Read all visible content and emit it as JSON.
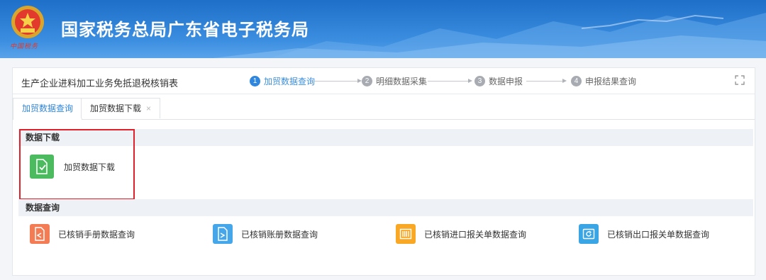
{
  "header": {
    "title": "国家税务总局广东省电子税务局",
    "signature": "中国税务"
  },
  "form": {
    "title": "生产企业进料加工业务免抵退税核销表"
  },
  "steps": [
    {
      "num": "1",
      "label": "加贸数据查询"
    },
    {
      "num": "2",
      "label": "明细数据采集"
    },
    {
      "num": "3",
      "label": "数据申报"
    },
    {
      "num": "4",
      "label": "申报结果查询"
    }
  ],
  "tabs": [
    {
      "label": "加贸数据查询"
    },
    {
      "label": "加贸数据下载",
      "close": "×"
    }
  ],
  "sections": {
    "download": {
      "title": "数据下载",
      "items": [
        {
          "label": "加贸数据下载",
          "icon": "download-doc-icon",
          "color": "#4cbb5f"
        }
      ]
    },
    "query": {
      "title": "数据查询",
      "items": [
        {
          "label": "已核销手册数据查询",
          "icon": "manual-doc-icon",
          "color": "#f47c54"
        },
        {
          "label": "已核销账册数据查询",
          "icon": "ledger-import-icon",
          "color": "#45a6ea"
        },
        {
          "label": "已核销进口报关单数据查询",
          "icon": "barcode-icon",
          "color": "#f8a824"
        },
        {
          "label": "已核销出口报关单数据查询",
          "icon": "refresh-doc-icon",
          "color": "#3aa5e5"
        }
      ]
    }
  },
  "colors": {
    "header": "#2f86de",
    "accent": "#2f86de",
    "highlight": "#e0202a"
  }
}
